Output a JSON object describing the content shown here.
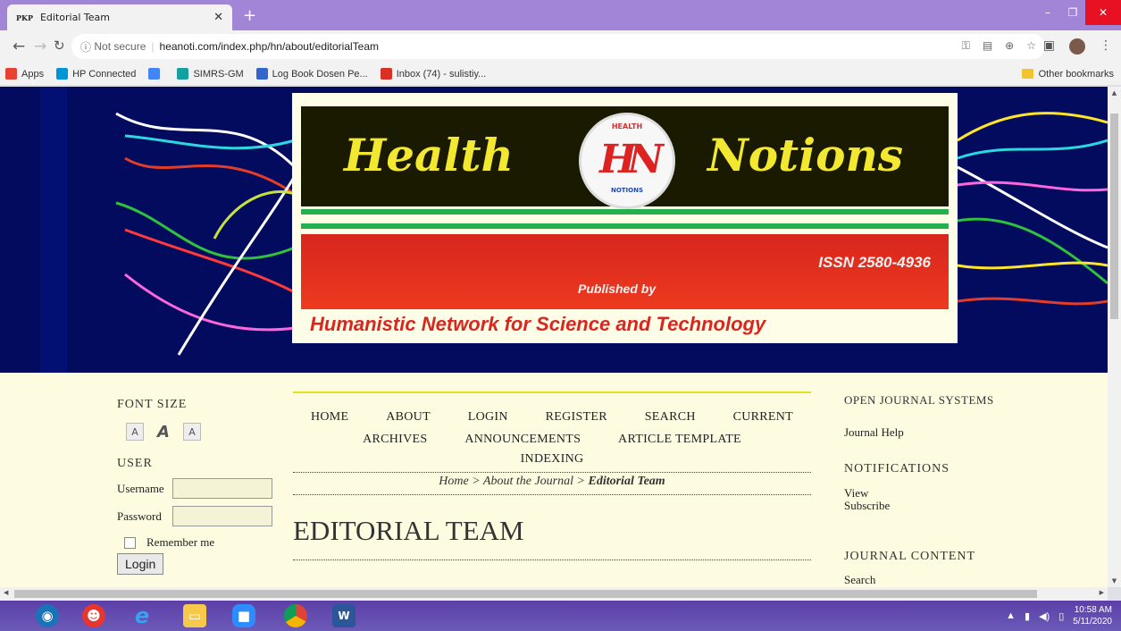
{
  "browser": {
    "tab_favicon": "PKP",
    "tab_title": "Editorial Team",
    "new_tab": "+",
    "address_security": "Not secure",
    "address_url": "heanoti.com/index.php/hn/about/editorialTeam",
    "bookmarks": [
      {
        "label": "Apps",
        "icon": "apps-grid-icon",
        "color": "#e94235"
      },
      {
        "label": "HP Connected",
        "icon": "hp-icon",
        "color": "#0096d6"
      },
      {
        "label": "",
        "icon": "google-icon",
        "color": "#4285f4"
      },
      {
        "label": "SIMRS-GM",
        "icon": "simrs-icon",
        "color": "#14a0a0"
      },
      {
        "label": "Log Book Dosen Pe...",
        "icon": "list-icon",
        "color": "#3366cc"
      },
      {
        "label": "Inbox (74) - sulistiy...",
        "icon": "gmail-icon",
        "color": "#d93025"
      }
    ],
    "other_bookmarks": "Other bookmarks"
  },
  "banner": {
    "logo_left": "Health",
    "logo_right": "Notions",
    "circle_top": "HEALTH",
    "circle_mono": "HN",
    "circle_bottom": "NOTIONS",
    "issn": "ISSN 2580-4936",
    "published_by": "Published by",
    "publisher": "Humanistic Network for Science and Technology"
  },
  "sidebar_left": {
    "font_size_title": "FONT SIZE",
    "font_small": "A",
    "font_default": "A",
    "font_large": "A",
    "user_title": "USER",
    "username_label": "Username",
    "password_label": "Password",
    "remember_label": "Remember me",
    "login_button": "Login"
  },
  "main": {
    "menu": [
      "HOME",
      "ABOUT",
      "LOGIN",
      "REGISTER",
      "SEARCH",
      "CURRENT",
      "ARCHIVES",
      "ANNOUNCEMENTS",
      "ARTICLE TEMPLATE",
      "INDEXING"
    ],
    "breadcrumb": {
      "home": "Home",
      "sep": ">",
      "about": "About the Journal",
      "current": "Editorial Team"
    },
    "page_title": "EDITORIAL TEAM"
  },
  "sidebar_right": {
    "ojs_title": "OPEN JOURNAL SYSTEMS",
    "journal_help": "Journal Help",
    "notifications_title": "NOTIFICATIONS",
    "view": "View",
    "subscribe": "Subscribe",
    "journal_content_title": "JOURNAL CONTENT",
    "search": "Search"
  },
  "taskbar": {
    "time": "10:58 AM",
    "date": "5/11/2020"
  }
}
